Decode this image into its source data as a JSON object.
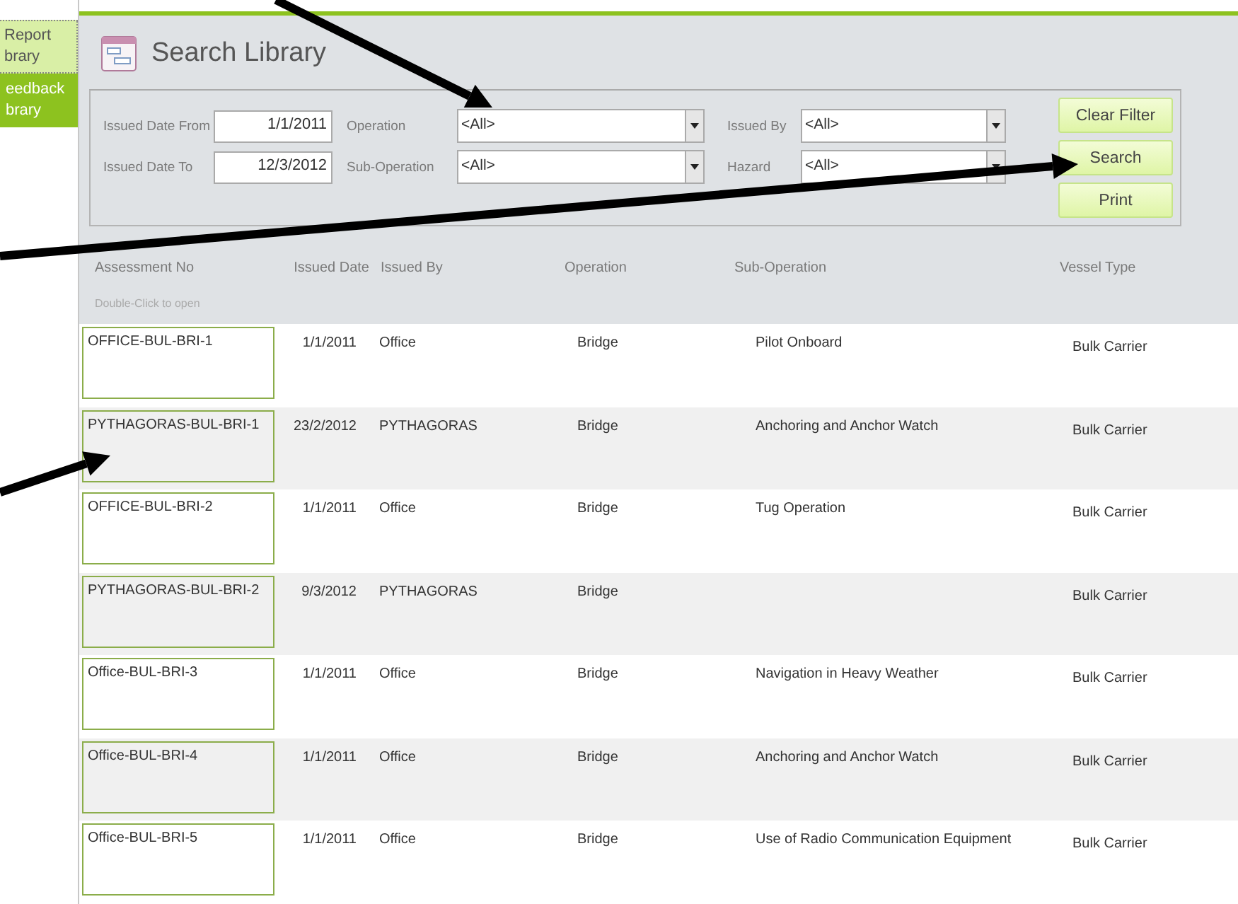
{
  "sidebar": {
    "items": [
      {
        "lines": [
          "Report",
          "brary"
        ],
        "selected": true
      },
      {
        "lines": [
          "eedback",
          "brary"
        ],
        "selected": false
      }
    ]
  },
  "form": {
    "title": "Search Library",
    "filter_rows": [
      [
        {
          "kind": "date",
          "label": "Issued Date From",
          "value": "1/1/2011"
        },
        {
          "kind": "combo",
          "label": "Operation",
          "value": "<All>"
        },
        {
          "kind": "combo",
          "label": "Issued By",
          "value": "<All>"
        }
      ],
      [
        {
          "kind": "date",
          "label": "Issued Date To",
          "value": "12/3/2012"
        },
        {
          "kind": "combo",
          "label": "Sub-Operation",
          "value": "<All>"
        },
        {
          "kind": "combo",
          "label": "Hazard",
          "value": "<All>"
        }
      ]
    ],
    "buttons": [
      "Clear Filter",
      "Search",
      "Print"
    ],
    "table": {
      "columns": [
        "Assessment No",
        "Issued Date",
        "Issued By",
        "Operation",
        "Sub-Operation",
        "Vessel Type"
      ],
      "hint": "Double-Click to open",
      "rows": [
        {
          "assessment_no": "OFFICE-BUL-BRI-1",
          "issued_date": "1/1/2011",
          "issued_by": "Office",
          "operation": "Bridge",
          "sub_operation": "Pilot Onboard",
          "vessel_type": "Bulk Carrier"
        },
        {
          "assessment_no": "PYTHAGORAS-BUL-BRI-1",
          "issued_date": "23/2/2012",
          "issued_by": "PYTHAGORAS",
          "operation": "Bridge",
          "sub_operation": "Anchoring and Anchor Watch",
          "vessel_type": "Bulk Carrier"
        },
        {
          "assessment_no": "OFFICE-BUL-BRI-2",
          "issued_date": "1/1/2011",
          "issued_by": "Office",
          "operation": "Bridge",
          "sub_operation": "Tug Operation",
          "vessel_type": "Bulk Carrier"
        },
        {
          "assessment_no": "PYTHAGORAS-BUL-BRI-2",
          "issued_date": "9/3/2012",
          "issued_by": "PYTHAGORAS",
          "operation": "Bridge",
          "vessel_type": "Bulk Carrier"
        },
        {
          "assessment_no": "Office-BUL-BRI-3",
          "issued_date": "1/1/2011",
          "issued_by": "Office",
          "operation": "Bridge",
          "sub_operation": "Navigation in Heavy Weather",
          "vessel_type": "Bulk Carrier"
        },
        {
          "assessment_no": "Office-BUL-BRI-4",
          "issued_date": "1/1/2011",
          "issued_by": "Office",
          "operation": "Bridge",
          "sub_operation": "Anchoring and Anchor Watch",
          "vessel_type": "Bulk Carrier"
        },
        {
          "assessment_no": "Office-BUL-BRI-5",
          "issued_date": "1/1/2011",
          "issued_by": "Office",
          "operation": "Bridge",
          "sub_operation": "Use of Radio Communication Equipment",
          "vessel_type": "Bulk Carrier"
        }
      ]
    }
  }
}
